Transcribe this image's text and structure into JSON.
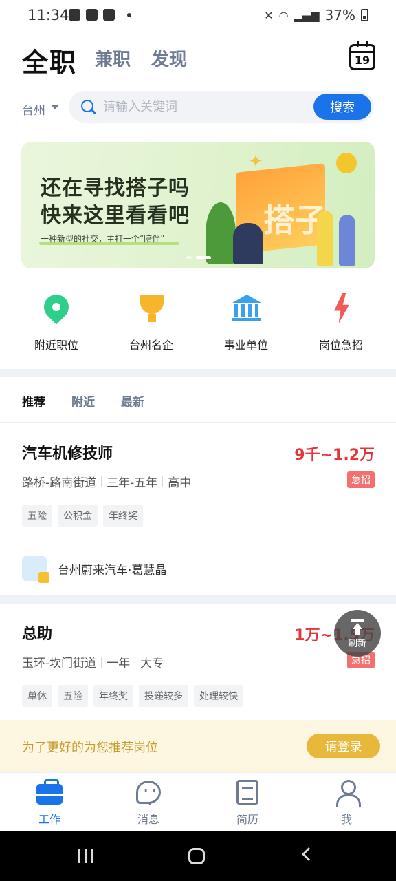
{
  "status_bar": {
    "time": "11:34",
    "battery": "37%"
  },
  "header": {
    "tabs": [
      "全职",
      "兼职",
      "发现"
    ],
    "calendar_day": "19"
  },
  "search": {
    "city": "台州",
    "placeholder": "请输入关键词",
    "value": "",
    "button_label": "搜索"
  },
  "banner": {
    "line1": "还在寻找搭子吗",
    "line2": "快来这里看看吧",
    "sub": "一种新型的社交，主打一个“陪伴”",
    "box_text": "搭子",
    "active_slide": 2,
    "slide_count": 2
  },
  "quick_entries": [
    {
      "label": "附近职位",
      "icon": "location-pin-icon"
    },
    {
      "label": "台州名企",
      "icon": "trophy-icon"
    },
    {
      "label": "事业单位",
      "icon": "government-building-icon"
    },
    {
      "label": "岗位急招",
      "icon": "lightning-icon"
    }
  ],
  "feed_tabs": [
    "推荐",
    "附近",
    "最新"
  ],
  "jobs": [
    {
      "title": "汽车机修技师",
      "salary": "9千~1.2万",
      "location": "路桥-路南街道",
      "experience": "三年-五年",
      "education": "高中",
      "badge": "急招",
      "tags": [
        "五险",
        "公积金",
        "年终奖"
      ],
      "company": "台州蔚来汽车·葛慧晶"
    },
    {
      "title": "总助",
      "salary": "1万~1.5万",
      "location": "玉环-坎门街道",
      "experience": "一年",
      "education": "大专",
      "badge": "急招",
      "tags": [
        "单休",
        "五险",
        "年终奖",
        "投递较多",
        "处理较快"
      ]
    }
  ],
  "refresh_label": "刷新",
  "login_prompt": {
    "text": "为了更好的为您推荐岗位",
    "button": "请登录"
  },
  "bottom_nav": [
    {
      "label": "工作",
      "icon": "briefcase-icon",
      "active": true
    },
    {
      "label": "消息",
      "icon": "chat-bubble-icon",
      "active": false
    },
    {
      "label": "简历",
      "icon": "resume-icon",
      "active": false
    },
    {
      "label": "我",
      "icon": "person-icon",
      "active": false
    }
  ],
  "colors": {
    "primary": "#1a73e8",
    "salary": "#e5353a",
    "urgent_badge": "#f2706f",
    "login_button": "#e8b83a",
    "banner_bg": "#dff2cd"
  }
}
